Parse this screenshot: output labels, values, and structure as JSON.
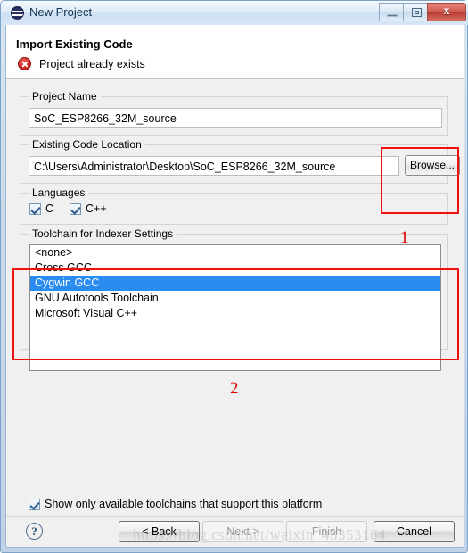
{
  "window": {
    "title": "New Project",
    "icon": "eclipse-wizard-icon",
    "buttons": {
      "minimize": "minimize-icon",
      "maximize": "maximize-icon",
      "close": "x"
    }
  },
  "header": {
    "title": "Import Existing Code",
    "status_icon": "error-icon",
    "status_message": "Project already exists"
  },
  "form": {
    "project_name": {
      "legend": "Project Name",
      "value": "SoC_ESP8266_32M_source",
      "placeholder": ""
    },
    "existing_code_location": {
      "legend": "Existing Code Location",
      "value": "C:\\Users\\Administrator\\Desktop\\SoC_ESP8266_32M_source",
      "placeholder": "",
      "browse_label": "Browse..."
    },
    "languages": {
      "legend": "Languages",
      "options": [
        {
          "label": "C",
          "checked": true
        },
        {
          "label": "C++",
          "checked": true
        }
      ]
    },
    "toolchain": {
      "legend": "Toolchain for Indexer Settings",
      "items": [
        {
          "label": "<none>",
          "selected": false
        },
        {
          "label": "Cross GCC",
          "selected": false
        },
        {
          "label": "Cygwin GCC",
          "selected": true
        },
        {
          "label": "GNU Autotools Toolchain",
          "selected": false
        },
        {
          "label": "Microsoft Visual C++",
          "selected": false
        }
      ],
      "selected_value": "Cygwin GCC"
    },
    "show_only_available": {
      "label": "Show only available toolchains that support this platform",
      "checked": true
    }
  },
  "footer": {
    "help_label": "?",
    "back_label": "< Back",
    "next_label": "Next >",
    "finish_label": "Finish",
    "cancel_label": "Cancel"
  },
  "annotations": [
    {
      "number": "1",
      "target": "browse-button-region"
    },
    {
      "number": "2",
      "target": "toolchain-list-region"
    }
  ],
  "watermark": "https://blog.csdn.net/weixin_43353164",
  "colors": {
    "selection_blue": "#2a8cf0",
    "annotation_red": "#dd0000",
    "error_red": "#cf2a23",
    "dialog_bg": "#f0f0f0"
  }
}
